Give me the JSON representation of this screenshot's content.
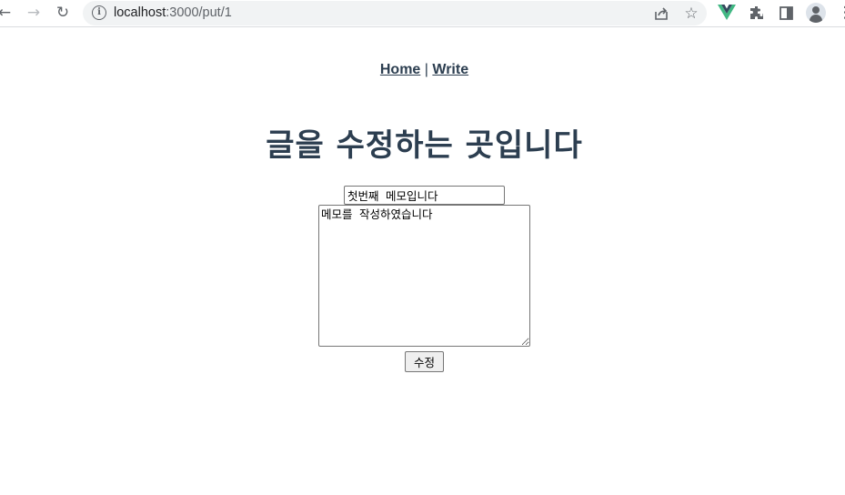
{
  "browser": {
    "url_host": "localhost",
    "url_path": ":3000/put/1",
    "icons": {
      "back": "back-arrow-icon",
      "forward": "forward-arrow-icon",
      "reload": "reload-icon",
      "info": "info-icon",
      "share": "share-icon",
      "bookmark": "star-icon",
      "vue_extension": "vue-devtools-icon",
      "extensions": "puzzle-icon",
      "side_panel": "side-panel-icon",
      "profile": "avatar-icon",
      "menu": "kebab-menu-icon"
    }
  },
  "nav": {
    "home_label": "Home",
    "separator": "|",
    "write_label": "Write"
  },
  "page": {
    "title": "글을 수정하는 곳입니다",
    "title_color": "#2c3e50"
  },
  "form": {
    "title_value": "첫번째 메모입니다",
    "content_value": "메모를 작성하였습니다",
    "submit_label": "수정"
  }
}
